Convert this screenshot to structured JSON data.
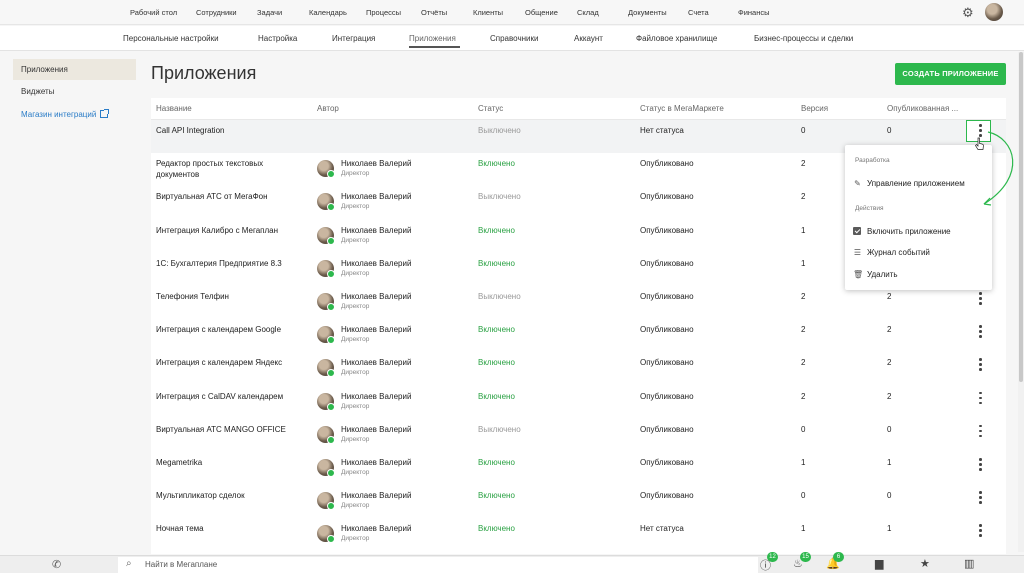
{
  "topnav": {
    "items": [
      "Рабочий стол",
      "Сотрудники",
      "Задачи",
      "Календарь",
      "Процессы",
      "Отчёты",
      "Клиенты",
      "Общение",
      "Склад",
      "Документы",
      "Счета",
      "Финансы"
    ]
  },
  "subnav": {
    "items": [
      "Персональные настройки",
      "Настройка",
      "Интеграция",
      "Приложения",
      "Справочники",
      "Аккаунт",
      "Файловое хранилище",
      "Бизнес-процессы и сделки"
    ],
    "active": "Приложения"
  },
  "sidebar": {
    "items": [
      "Приложения",
      "Виджеты"
    ],
    "link": "Магазин интеграций"
  },
  "page": {
    "title": "Приложения",
    "create_button": "СОЗДАТЬ ПРИЛОЖЕНИЕ"
  },
  "table": {
    "headers": [
      "Название",
      "Автор",
      "Статус",
      "Статус в МегаМаркете",
      "Версия",
      "Опубликованная ..."
    ],
    "rows": [
      {
        "name": "Call API Integration",
        "author": "",
        "role": "",
        "status": "Выключено",
        "market": "Нет статуса",
        "version": "0",
        "published": "0"
      },
      {
        "name": "Редактор простых текстовых документов",
        "author": "Николаев Валерий",
        "role": "Директор",
        "status": "Включено",
        "market": "Опубликовано",
        "version": "2",
        "published": "2"
      },
      {
        "name": "Виртуальная АТС от МегаФон",
        "author": "Николаев Валерий",
        "role": "Директор",
        "status": "Выключено",
        "market": "Опубликовано",
        "version": "2",
        "published": "2"
      },
      {
        "name": "Интеграция Калибро с Мегаплан",
        "author": "Николаев Валерий",
        "role": "Директор",
        "status": "Включено",
        "market": "Опубликовано",
        "version": "1",
        "published": "1"
      },
      {
        "name": "1С: Бухгалтерия Предприятие 8.3",
        "author": "Николаев Валерий",
        "role": "Директор",
        "status": "Включено",
        "market": "Опубликовано",
        "version": "1",
        "published": "1"
      },
      {
        "name": "Телефония Телфин",
        "author": "Николаев Валерий",
        "role": "Директор",
        "status": "Выключено",
        "market": "Опубликовано",
        "version": "2",
        "published": "2"
      },
      {
        "name": "Интеграция с календарем Google",
        "author": "Николаев Валерий",
        "role": "Директор",
        "status": "Включено",
        "market": "Опубликовано",
        "version": "2",
        "published": "2"
      },
      {
        "name": "Интеграция с календарем Яндекс",
        "author": "Николаев Валерий",
        "role": "Директор",
        "status": "Включено",
        "market": "Опубликовано",
        "version": "2",
        "published": "2"
      },
      {
        "name": "Интеграция с CalDAV календарем",
        "author": "Николаев Валерий",
        "role": "Директор",
        "status": "Включено",
        "market": "Опубликовано",
        "version": "2",
        "published": "2"
      },
      {
        "name": "Виртуальная АТС MANGO OFFICE",
        "author": "Николаев Валерий",
        "role": "Директор",
        "status": "Выключено",
        "market": "Опубликовано",
        "version": "0",
        "published": "0"
      },
      {
        "name": "Megametrika",
        "author": "Николаев Валерий",
        "role": "Директор",
        "status": "Включено",
        "market": "Опубликовано",
        "version": "1",
        "published": "1"
      },
      {
        "name": "Мультипликатор сделок",
        "author": "Николаев Валерий",
        "role": "Директор",
        "status": "Включено",
        "market": "Опубликовано",
        "version": "0",
        "published": "0"
      },
      {
        "name": "Ночная тема",
        "author": "Николаев Валерий",
        "role": "Директор",
        "status": "Включено",
        "market": "Нет статуса",
        "version": "1",
        "published": "1"
      }
    ]
  },
  "menu": {
    "section_dev": "Разработка",
    "manage": "Управление приложением",
    "section_actions": "Действия",
    "enable": "Включить приложение",
    "log": "Журнал событий",
    "delete": "Удалить"
  },
  "bottombar": {
    "search_placeholder": "Найти в Мегаплане",
    "badges": [
      "12",
      "15",
      "6"
    ]
  },
  "colors": {
    "accent": "#2db84d",
    "link": "#2a7cc7",
    "status_on": "#2aa143",
    "status_off": "#999999"
  }
}
